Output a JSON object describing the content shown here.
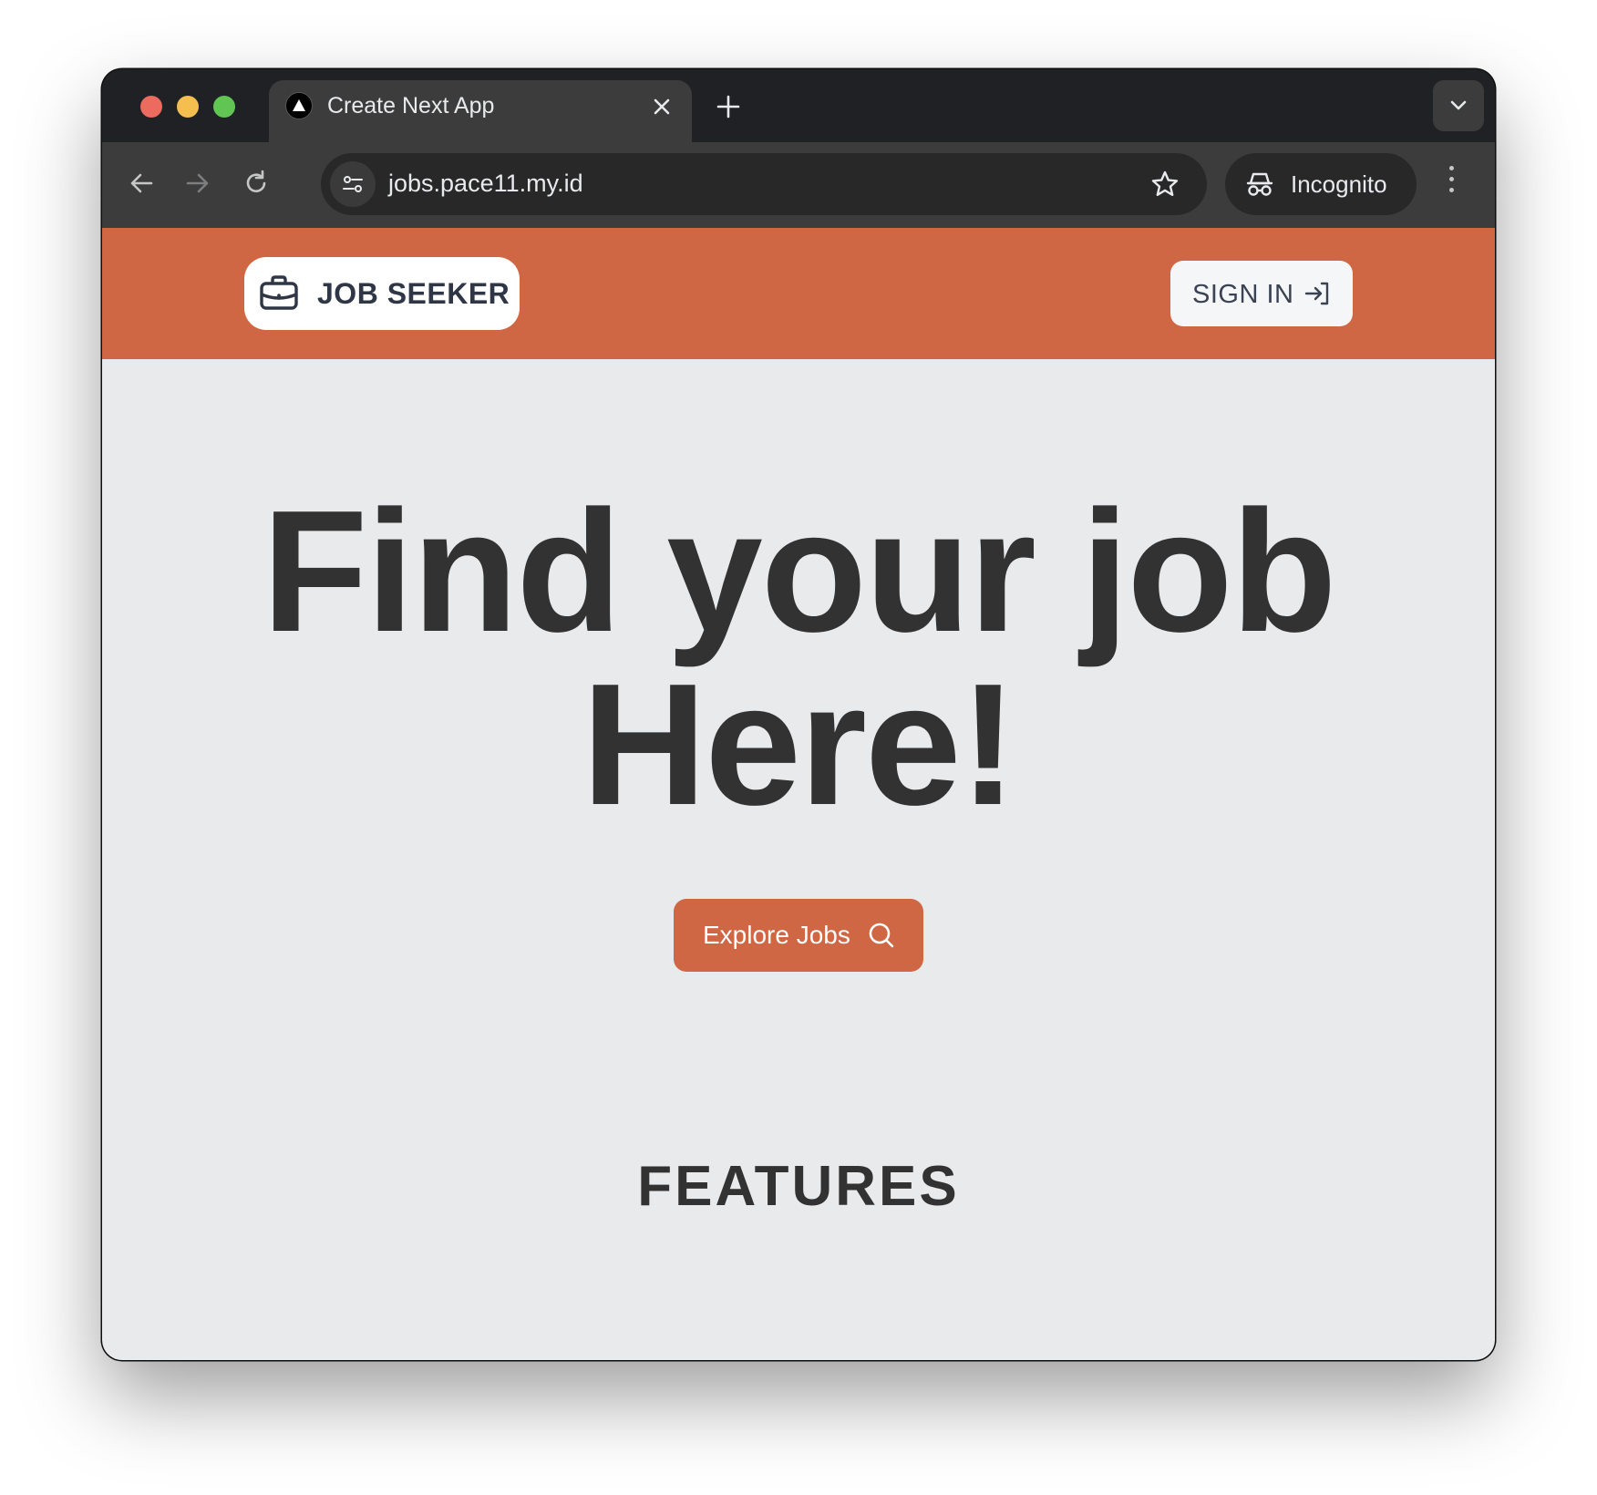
{
  "browser": {
    "tab_title": "Create Next App",
    "url": "jobs.pace11.my.id",
    "incognito_label": "Incognito",
    "icons": [
      "close-icon",
      "plus-icon",
      "chevron-down-icon",
      "back-arrow-icon",
      "forward-arrow-icon",
      "reload-icon",
      "tune-icon",
      "star-icon",
      "incognito-icon",
      "more-vert-icon"
    ]
  },
  "navbar": {
    "brand_label": "JOB SEEKER",
    "brand_icon": "briefcase-icon",
    "signin_label": "SIGN IN",
    "signin_icon": "login-arrow-icon"
  },
  "hero": {
    "title_line1": "Find your job",
    "title_line2": "Here!",
    "cta_label": "Explore Jobs",
    "cta_icon": "search-icon"
  },
  "features": {
    "title": "FEATURES"
  },
  "colors": {
    "accent": "#d06744",
    "page_bg": "#e9eaec",
    "heading": "#323232",
    "chrome_dark": "#202124",
    "chrome_toolbar": "#3c3c3c"
  }
}
